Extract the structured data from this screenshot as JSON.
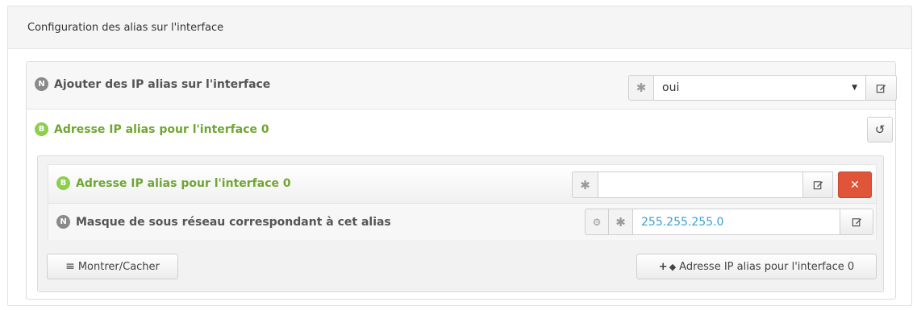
{
  "panel": {
    "title": "Configuration des alias sur l'interface"
  },
  "row_add_alias": {
    "badge": "N",
    "label": "Ajouter des IP alias sur l'interface",
    "value": "oui"
  },
  "row_alias_group": {
    "badge": "B",
    "label": "Adresse IP alias pour l'interface 0"
  },
  "entry": {
    "ip": {
      "badge": "B",
      "label": "Adresse IP alias pour l'interface 0",
      "value": ""
    },
    "mask": {
      "badge": "N",
      "label": "Masque de sous réseau correspondant à cet alias",
      "value": "255.255.255.0"
    }
  },
  "buttons": {
    "toggle": "Montrer/Cacher",
    "add": "Adresse IP alias pour l'interface 0"
  },
  "colors": {
    "green": "#6fa631",
    "badge_grey": "#8a8a8a",
    "badge_green": "#8ccf4d",
    "danger": "#e0553a",
    "link": "#3a9ed8"
  },
  "icons": [
    "asterisk-icon",
    "caret-down-icon",
    "edit-icon",
    "reset-icon",
    "remove-icon",
    "gears-icon",
    "menu-icon",
    "plus-icon",
    "tag-icon"
  ]
}
